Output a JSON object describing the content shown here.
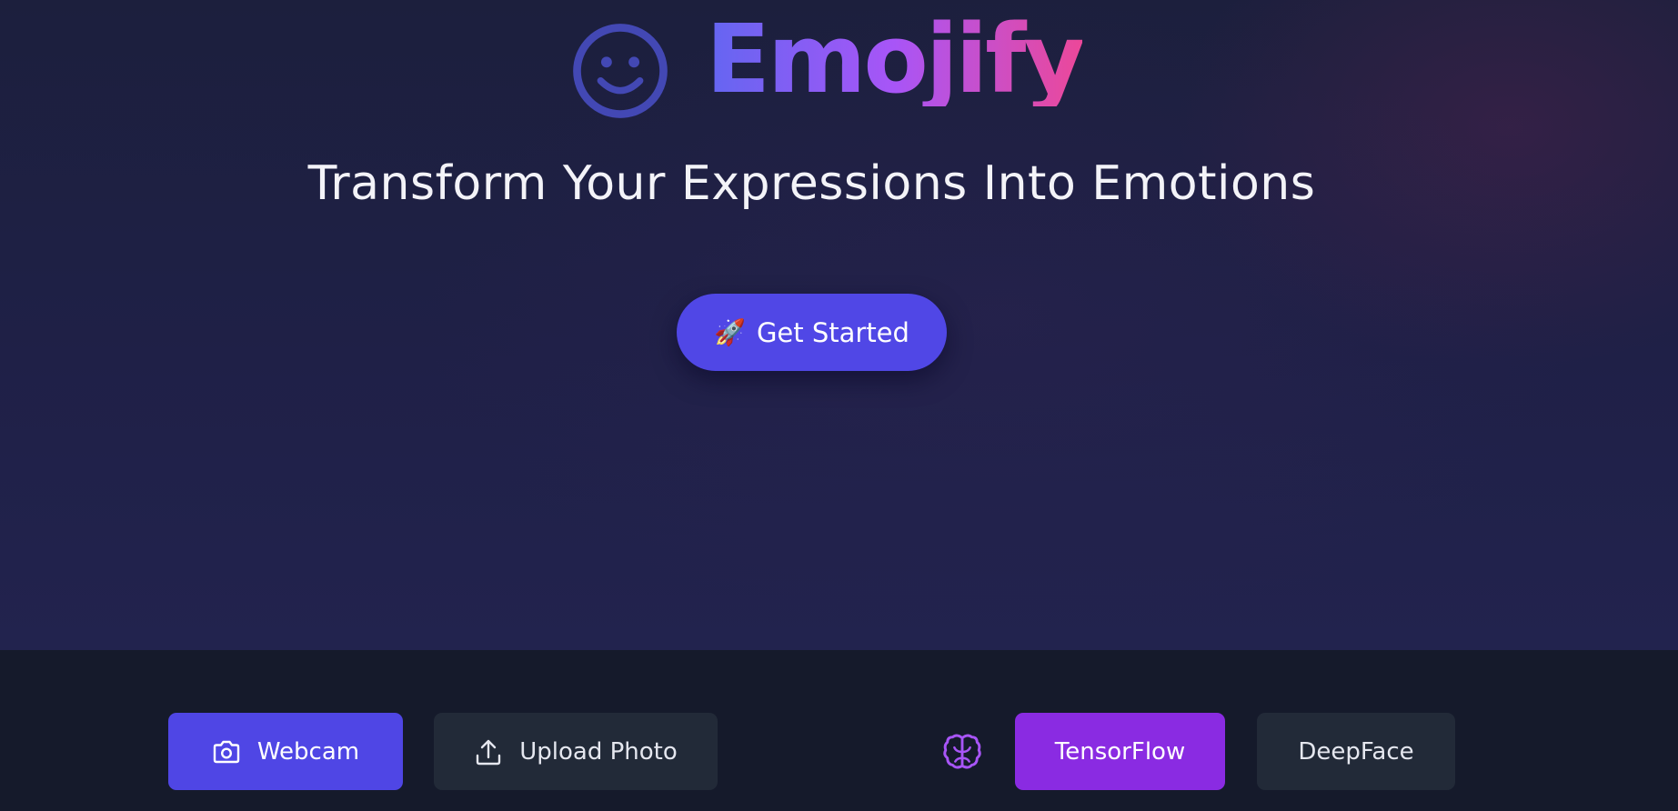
{
  "brand": {
    "name": "Emojify",
    "logo_icon": "smiley-face-icon"
  },
  "hero": {
    "tagline": "Transform Your Expressions Into Emotions",
    "cta_icon": "🚀",
    "cta_label": "Get Started"
  },
  "controls": {
    "webcam_label": "Webcam",
    "webcam_icon": "camera-icon",
    "upload_label": "Upload Photo",
    "upload_icon": "upload-icon",
    "model_icon": "brain-icon",
    "tensorflow_label": "TensorFlow",
    "deepface_label": "DeepFace"
  },
  "colors": {
    "accent": "#4f46e5",
    "tensorflow_active": "#8a2be2",
    "brand_gradient": [
      "#6366f1",
      "#a855f7",
      "#ec4899"
    ]
  }
}
